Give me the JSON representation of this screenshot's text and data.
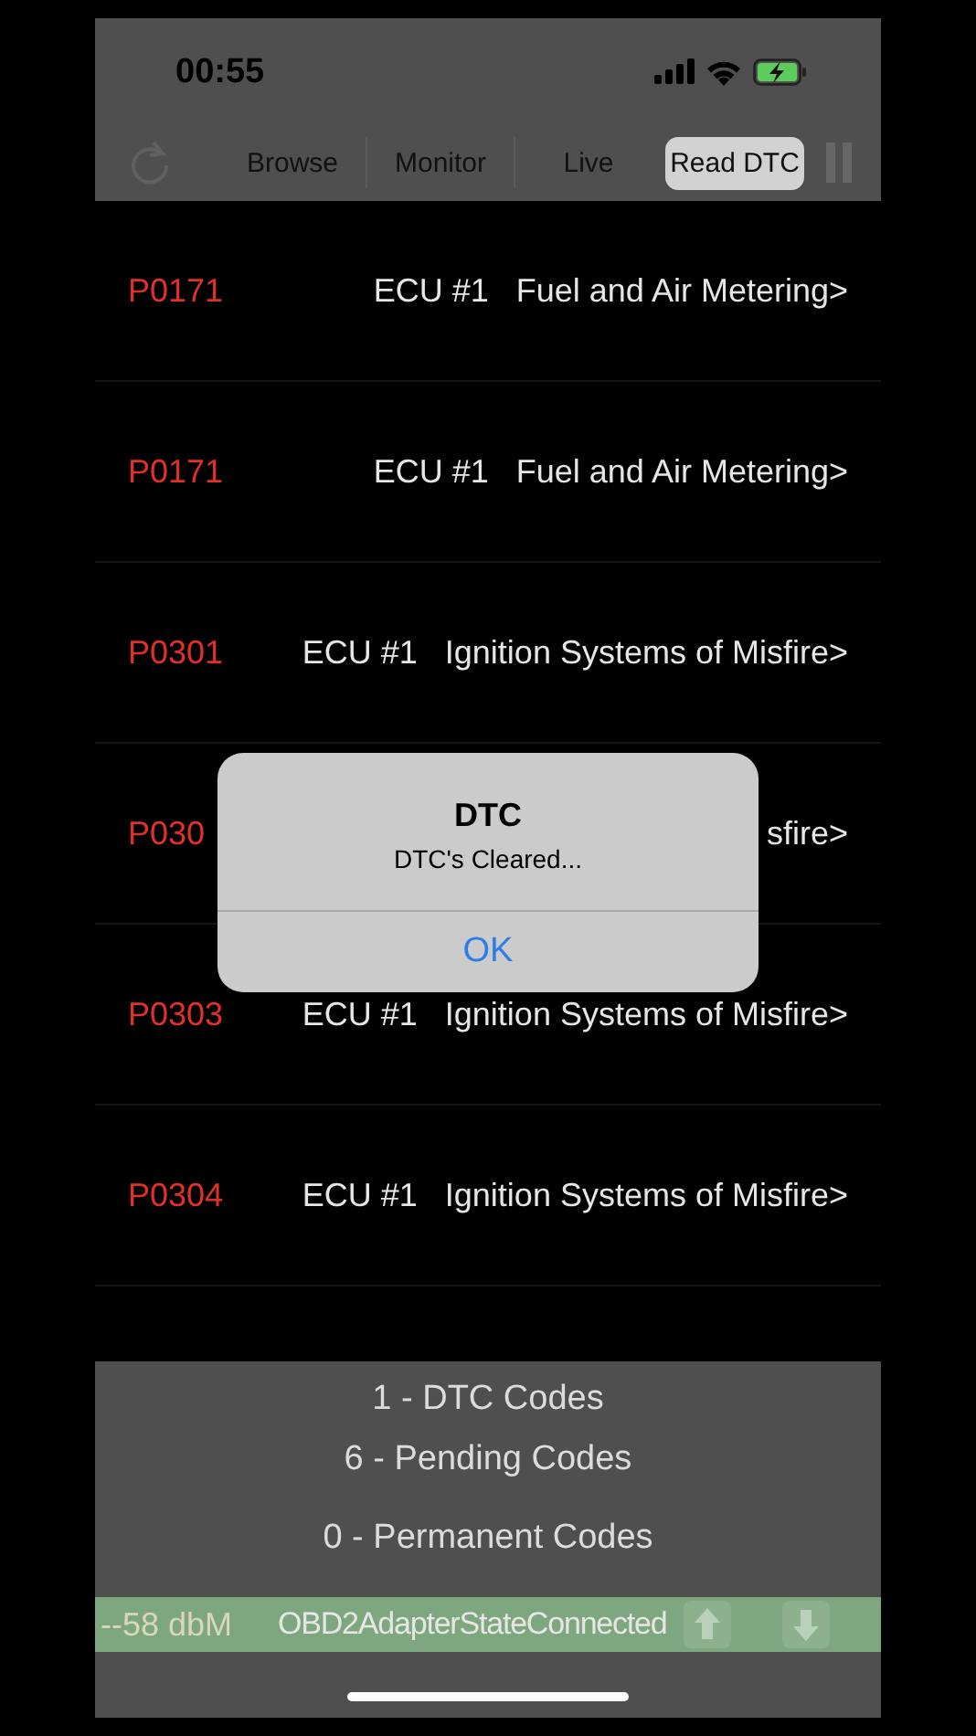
{
  "status_bar": {
    "time": "00:55"
  },
  "tabs": [
    {
      "label": "Browse",
      "selected": false
    },
    {
      "label": "Monitor",
      "selected": false
    },
    {
      "label": "Live",
      "selected": false
    },
    {
      "label": "Read DTC",
      "selected": true
    }
  ],
  "dtc_list": [
    {
      "code": "P0171",
      "ecu": "ECU #1",
      "description": "Fuel and Air Metering>"
    },
    {
      "code": "P0171",
      "ecu": "ECU #1",
      "description": "Fuel and Air Metering>"
    },
    {
      "code": "P0301",
      "ecu": "ECU #1",
      "description": "Ignition Systems of Misfire>"
    },
    {
      "code": "P030",
      "description": "sfire>"
    },
    {
      "code": "P0303",
      "ecu": "ECU #1",
      "description": "Ignition Systems of Misfire>"
    },
    {
      "code": "P0304",
      "ecu": "ECU #1",
      "description": "Ignition Systems of Misfire>"
    }
  ],
  "alert": {
    "title": "DTC",
    "message": "DTC's Cleared...",
    "button": "OK"
  },
  "summary": [
    "1 - DTC Codes",
    "6 - Pending Codes",
    "0 - Permanent Codes"
  ],
  "adapter_bar": {
    "signal": "--58 dbM",
    "state": "OBD2AdapterStateConnected"
  }
}
